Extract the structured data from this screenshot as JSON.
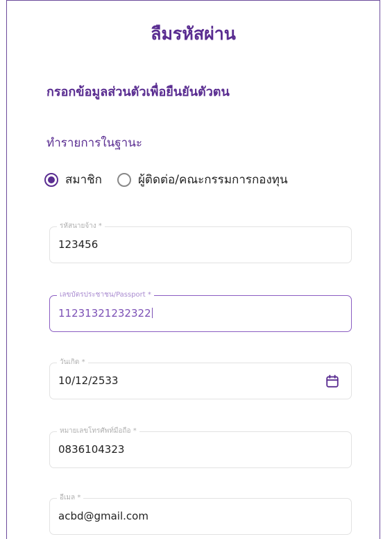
{
  "header": {
    "title": "ลืมรหัสผ่าน"
  },
  "section": {
    "title": "กรอกข้อมูลส่วนตัวเพื่อยืนยันตัวตน"
  },
  "role": {
    "label": "ทำรายการในฐานะ",
    "options": [
      {
        "label": "สมาชิก",
        "selected": true
      },
      {
        "label": "ผู้ติดต่อ/คณะกรรมการกองทุน",
        "selected": false
      }
    ]
  },
  "form": {
    "employer_code": {
      "label": "รหัสนายจ้าง *",
      "value": "123456"
    },
    "id_card": {
      "label": "เลขบัตรประชาชน/Passport *",
      "value": "11231321232322"
    },
    "birth_date": {
      "label": "วันเกิด *",
      "value": "10/12/2533",
      "icon": "calendar-icon"
    },
    "phone": {
      "label": "หมายเลขโทรศัพท์มือถือ *",
      "value": "0836104323"
    },
    "email": {
      "label": "อีเมล *",
      "value": "acbd@gmail.com"
    }
  },
  "colors": {
    "accent": "#5a2d91",
    "focus_border": "#8a5cc2",
    "field_border": "#e2e2e2"
  }
}
